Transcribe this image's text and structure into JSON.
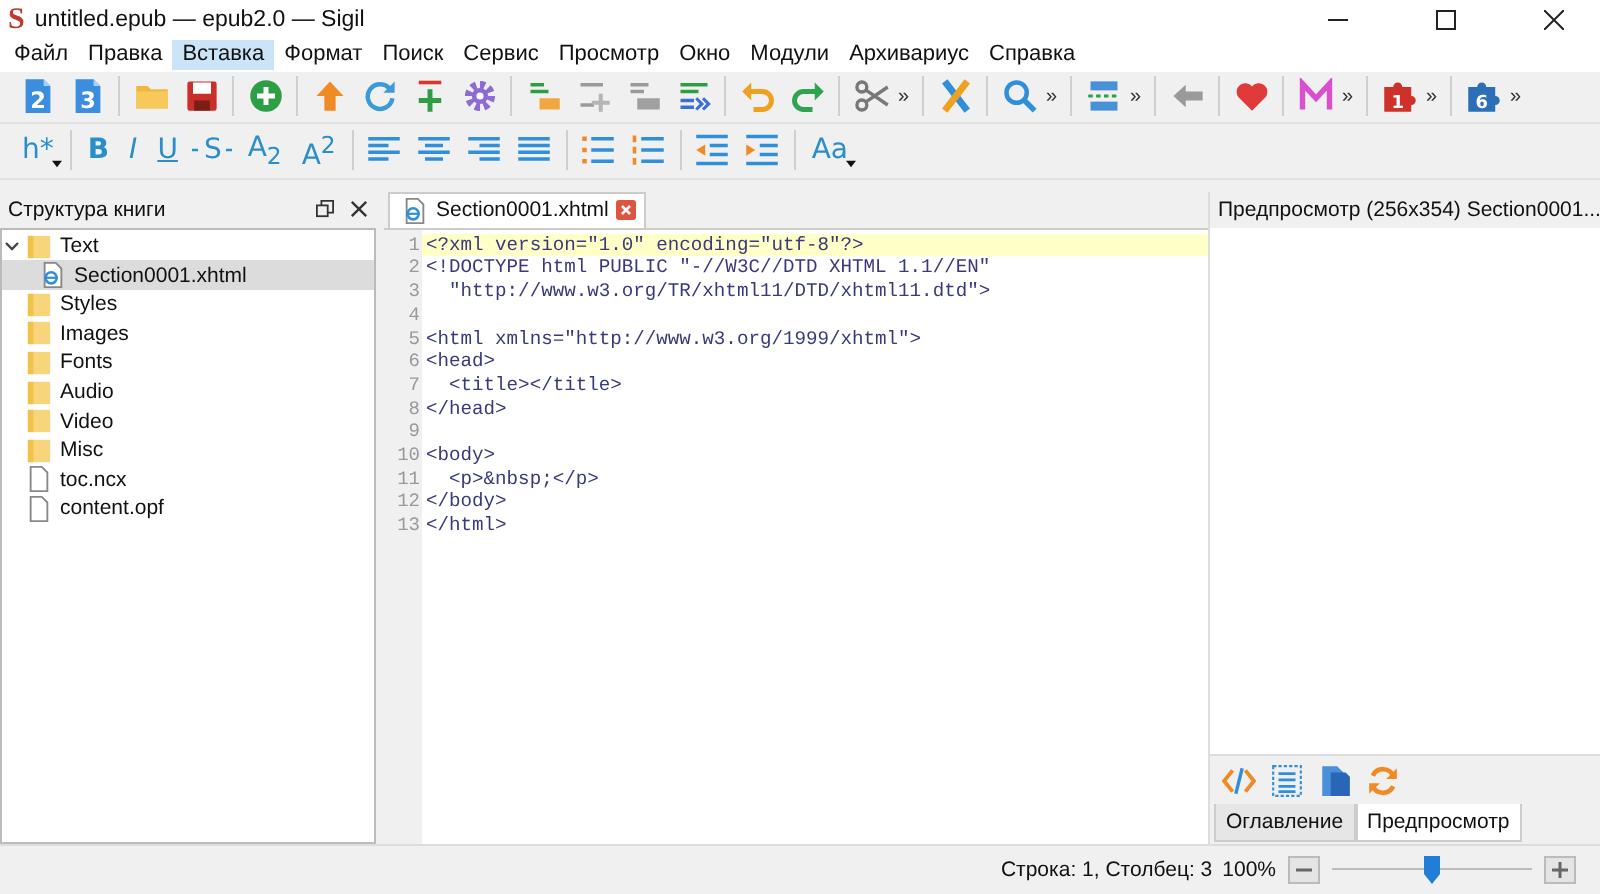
{
  "window": {
    "logo": "S",
    "title": "untitled.epub — epub2.0 — Sigil"
  },
  "menu": [
    {
      "label": "Файл",
      "selected": false
    },
    {
      "label": "Правка",
      "selected": false
    },
    {
      "label": "Вставка",
      "selected": true
    },
    {
      "label": "Формат",
      "selected": false
    },
    {
      "label": "Поиск",
      "selected": false
    },
    {
      "label": "Сервис",
      "selected": false
    },
    {
      "label": "Просмотр",
      "selected": false
    },
    {
      "label": "Окно",
      "selected": false
    },
    {
      "label": "Модули",
      "selected": false
    },
    {
      "label": "Архивариус",
      "selected": false
    },
    {
      "label": "Справка",
      "selected": false
    }
  ],
  "toolbar_badges": [
    "2",
    "3",
    "1",
    "6"
  ],
  "toolbar_overflow": [
    "»",
    "»",
    "»",
    "»",
    "»",
    "»"
  ],
  "format_toolbar": {
    "labels": [
      "h*",
      "B",
      "I",
      "U",
      "S",
      "A$_{2}$",
      "A$^{2}$",
      "Aa"
    ]
  },
  "book_browser": {
    "title": "Структура книги",
    "items": [
      {
        "label": "Text",
        "kind": "folder",
        "expanded": true,
        "selected": false,
        "children": [
          {
            "label": "Section0001.xhtml",
            "kind": "xhtml",
            "selected": true
          }
        ]
      },
      {
        "label": "Styles",
        "kind": "folder",
        "selected": false
      },
      {
        "label": "Images",
        "kind": "folder",
        "selected": false
      },
      {
        "label": "Fonts",
        "kind": "folder",
        "selected": false
      },
      {
        "label": "Audio",
        "kind": "folder",
        "selected": false
      },
      {
        "label": "Video",
        "kind": "folder",
        "selected": false
      },
      {
        "label": "Misc",
        "kind": "folder",
        "selected": false
      },
      {
        "label": "toc.ncx",
        "kind": "file",
        "selected": false
      },
      {
        "label": "content.opf",
        "kind": "file",
        "selected": false
      }
    ]
  },
  "editor": {
    "tabs": [
      {
        "label": "Section0001.xhtml",
        "selected": true
      }
    ],
    "lines": [
      {
        "number": "1",
        "text": "<?xml version=\"1.0\" encoding=\"utf-8\"?>",
        "current": true
      },
      {
        "number": "2",
        "text": "<!DOCTYPE html PUBLIC \"-//W3C//DTD XHTML 1.1//EN\"",
        "current": false
      },
      {
        "number": "3",
        "text": "  \"http://www.w3.org/TR/xhtml11/DTD/xhtml11.dtd\">",
        "current": false
      },
      {
        "number": "4",
        "current": false
      },
      {
        "number": "5",
        "text": "<html xmlns=\"http://www.w3.org/1999/xhtml\">",
        "current": false
      },
      {
        "number": "6",
        "text": "<head>",
        "current": false
      },
      {
        "number": "7",
        "text": "  <title></title>",
        "current": false
      },
      {
        "number": "8",
        "text": "</head>",
        "current": false
      },
      {
        "number": "9",
        "current": false
      },
      {
        "number": "10",
        "text": "<body>",
        "current": false
      },
      {
        "number": "11",
        "text": "  <p>&nbsp;</p>",
        "current": false
      },
      {
        "number": "12",
        "text": "</body>",
        "current": false
      },
      {
        "number": "13",
        "text": "</html>",
        "current": false
      }
    ]
  },
  "preview": {
    "title": "Предпросмотр (256x354) Section0001...",
    "tabs": [
      {
        "label": "Оглавление",
        "selected": false
      },
      {
        "label": "Предпросмотр",
        "selected": true
      }
    ]
  },
  "status_bar": {
    "position": "Строка: 1, Столбец: 3",
    "zoom": "100%",
    "zoom_slider": {
      "level": 0.5
    }
  }
}
